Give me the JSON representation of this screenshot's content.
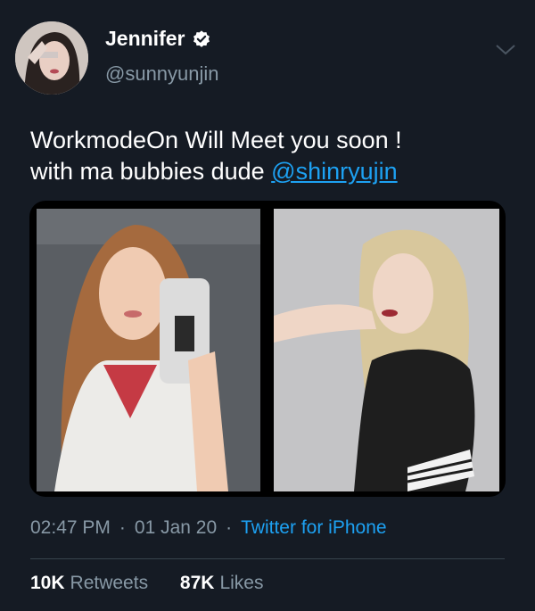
{
  "user": {
    "name": "Jennifer",
    "handle": "@sunnyunjin",
    "verified_icon": "verified-badge-icon"
  },
  "menu_icon": "chevron-down-icon",
  "tweet": {
    "text_line1": "WorkmodeOn Will Meet you soon !",
    "text_line2_prefix": "with ma bubbies dude ",
    "mention": "@shinryujin"
  },
  "media": {
    "left_photo": "selfie-photo",
    "right_photo": "portrait-photo"
  },
  "meta": {
    "time": "02:47 PM",
    "separator": "·",
    "date": "01 Jan 20",
    "source": "Twitter for iPhone"
  },
  "stats": {
    "retweets_count": "10K",
    "retweets_label": "Retweets",
    "likes_count": "87K",
    "likes_label": "Likes"
  },
  "colors": {
    "background": "#151b24",
    "link": "#1da1f2",
    "secondary_text": "#8899a6",
    "divider": "#38444d"
  }
}
